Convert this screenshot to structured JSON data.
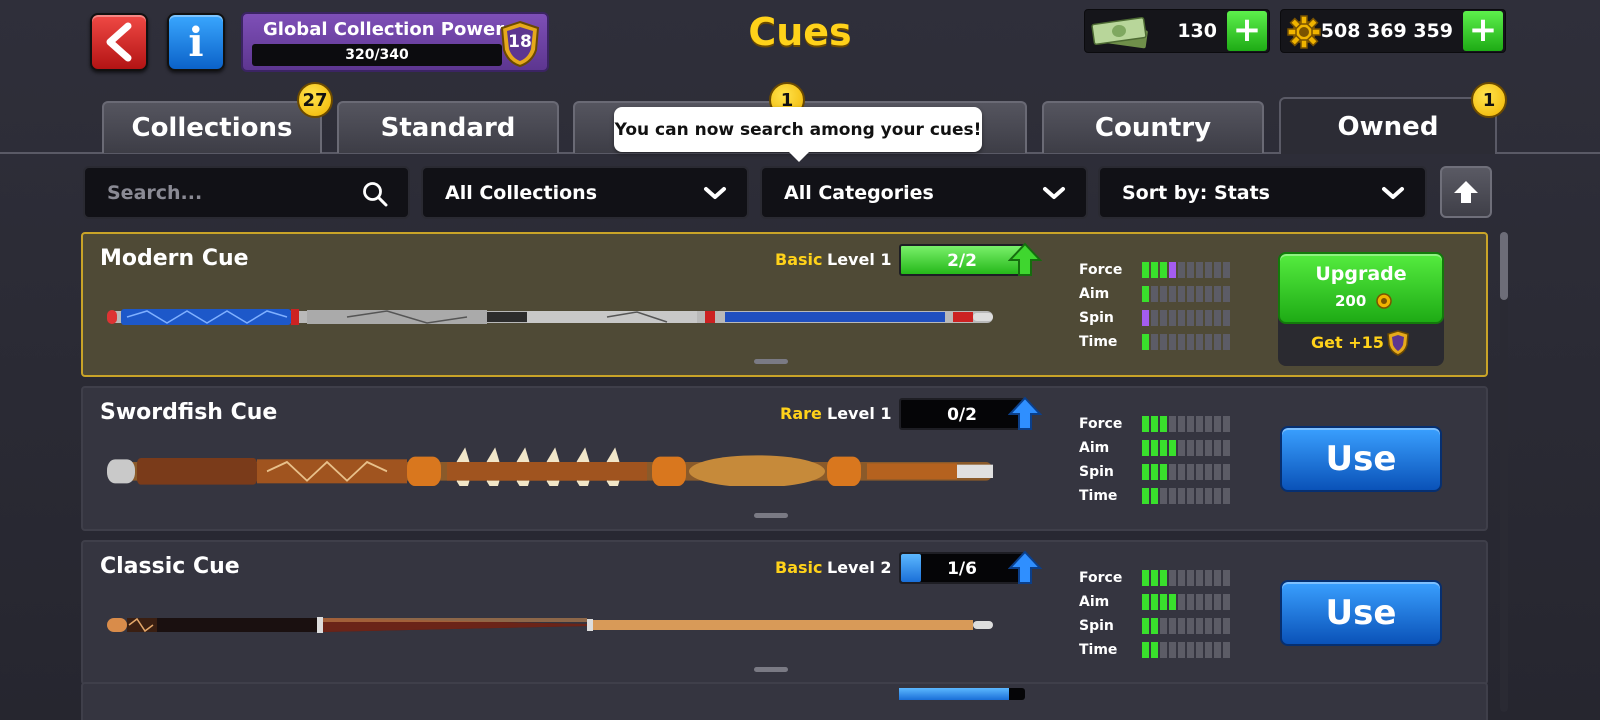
{
  "header": {
    "title": "Cues",
    "collection_power": {
      "label": "Global Collection Power",
      "progress": "320/340",
      "level": "18"
    },
    "cash": "130",
    "coins": "508 369 359"
  },
  "tabs": [
    {
      "label": "Collections",
      "badge": "27"
    },
    {
      "label": "Standard"
    },
    {
      "label": "",
      "badge": "1"
    },
    {
      "label": "Country"
    },
    {
      "label": "Owned",
      "badge": "1",
      "active": true
    }
  ],
  "tooltip": "You can now search among your cues!",
  "filters": {
    "search_placeholder": "Search...",
    "collections": "All Collections",
    "categories": "All Categories",
    "sort": "Sort by: Stats"
  },
  "stat_labels": [
    "Force",
    "Aim",
    "Spin",
    "Time"
  ],
  "cues": [
    {
      "name": "Modern Cue",
      "rarity": "Basic",
      "level": "Level 1",
      "progress": "2/2",
      "progress_fraction": 1.0,
      "stats": {
        "force": 3,
        "aim": 1,
        "spin": 1,
        "time": 1
      },
      "action": "Upgrade",
      "upgrade_cost": "200",
      "get_label": "Get +15"
    },
    {
      "name": "Swordfish Cue",
      "rarity": "Rare",
      "level": "Level 1",
      "progress": "0/2",
      "progress_fraction": 0,
      "stats": {
        "force": 3,
        "aim": 4,
        "spin": 3,
        "time": 2
      },
      "action": "Use"
    },
    {
      "name": "Classic Cue",
      "rarity": "Basic",
      "level": "Level 2",
      "progress": "1/6",
      "progress_fraction": 0.16,
      "stats": {
        "force": 3,
        "aim": 4,
        "spin": 2,
        "time": 2
      },
      "action": "Use"
    }
  ]
}
